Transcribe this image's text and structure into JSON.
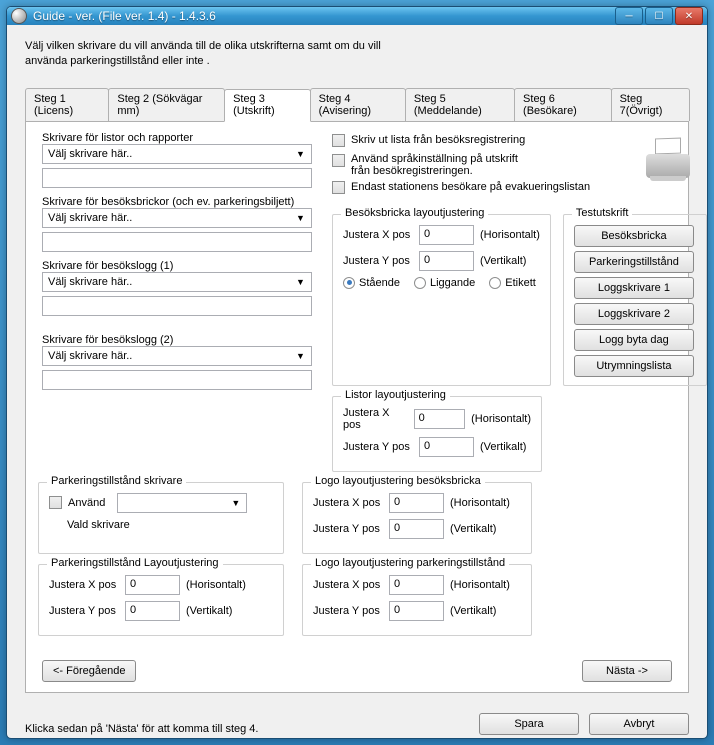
{
  "title": "Guide - ver. (File ver. 1.4) - 1.4.3.6",
  "intro": "Välj vilken skrivare du vill använda till de olika utskrifterna samt om du vill använda parkeringstillstånd eller inte .",
  "tabs": [
    "Steg 1 (Licens)",
    "Steg 2 (Sökvägar mm)",
    "Steg 3 (Utskrift)",
    "Steg 4 (Avisering)",
    "Steg 5 (Meddelande)",
    "Steg 6 (Besökare)",
    "Steg 7(Övrigt)"
  ],
  "labels": {
    "printer_reports": "Skrivare för listor och rapporter",
    "printer_badges": "Skrivare för besöksbrickor (och ev. parkeringsbiljett)",
    "printer_log1": "Skrivare för besökslogg (1)",
    "printer_log2": "Skrivare för besökslogg (2)",
    "combo_placeholder": "Välj skrivare här..",
    "chk1": "Skriv ut lista från besöksregistrering",
    "chk2a": "Använd språkinställning  på utskrift",
    "chk2b": "från besökregistreringen.",
    "chk3": "Endast stationens besökare på evakueringslistan",
    "grp_badge": "Besöksbricka layoutjustering",
    "grp_list": "Listor layoutjustering",
    "grp_logo_badge": "Logo layoutjustering besöksbricka",
    "grp_logo_park": "Logo layoutjustering parkeringstillstånd",
    "grp_park_printer": "Parkeringstillstånd skrivare",
    "grp_park_layout": "Parkeringstillstånd Layoutjustering",
    "grp_test": "Testutskrift",
    "justera_x": "Justera X pos",
    "justera_y": "Justera Y pos",
    "horisontalt": "(Horisontalt)",
    "vertikalt": "(Vertikalt)",
    "staende": "Stående",
    "liggande": "Liggande",
    "etikett": "Etikett",
    "anvand": "Använd",
    "vald": "Vald skrivare",
    "prev": "<- Föregående",
    "next": "Nästa ->"
  },
  "values": {
    "badge_x": "0",
    "badge_y": "0",
    "list_x": "0",
    "list_y": "0",
    "logo_badge_x": "0",
    "logo_badge_y": "0",
    "logo_park_x": "0",
    "logo_park_y": "0",
    "park_x": "0",
    "park_y": "0"
  },
  "testbtns": [
    "Besöksbricka",
    "Parkeringstillstånd",
    "Loggskrivare 1",
    "Loggskrivare 2",
    "Logg byta dag",
    "Utrymningslista"
  ],
  "footer": {
    "msg": "Klicka sedan på 'Nästa' för att komma till steg 4.",
    "save": "Spara",
    "cancel": "Avbryt"
  }
}
